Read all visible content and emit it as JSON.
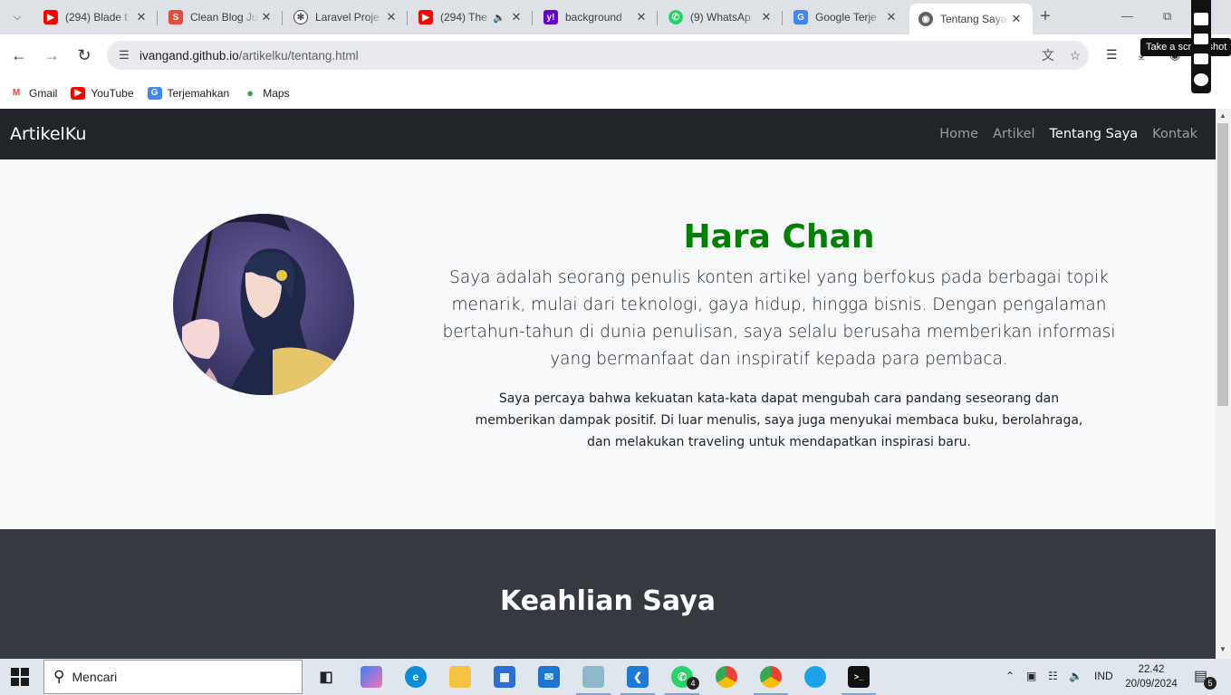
{
  "browser": {
    "tabs": [
      {
        "title": "(294) Blade t",
        "icon": "youtube-icon",
        "color": "#ff0000"
      },
      {
        "title": "Clean Blog Ju",
        "icon": "s-logo-icon",
        "color": "#e44c3c"
      },
      {
        "title": "Laravel Proje",
        "icon": "openai-icon",
        "color": "#444444"
      },
      {
        "title": "(294) The",
        "icon": "youtube-icon",
        "color": "#ff0000",
        "audio": true
      },
      {
        "title": "background",
        "icon": "yahoo-icon",
        "color": "#6001d2"
      },
      {
        "title": "(9) WhatsAp",
        "icon": "whatsapp-icon",
        "color": "#25d366"
      },
      {
        "title": "Google Terje",
        "icon": "google-translate-icon",
        "color": "#4285f4"
      },
      {
        "title": "Tentang Saya",
        "icon": "globe-icon",
        "color": "#5f6368",
        "active": true
      }
    ],
    "url_host": "ivangand.github.io",
    "url_path": "/artikelku/tentang.html",
    "bookmarks": [
      {
        "label": "Gmail",
        "icon": "gmail-icon"
      },
      {
        "label": "YouTube",
        "icon": "youtube-icon"
      },
      {
        "label": "Terjemahkan",
        "icon": "google-translate-icon"
      },
      {
        "label": "Maps",
        "icon": "maps-pin-icon"
      }
    ],
    "extension_tooltip": "Take a screenshot"
  },
  "site": {
    "brand": "ArtikelKu",
    "nav": [
      {
        "label": "Home",
        "active": false
      },
      {
        "label": "Artikel",
        "active": false
      },
      {
        "label": "Tentang Saya",
        "active": true
      },
      {
        "label": "Kontak",
        "active": false
      }
    ],
    "about": {
      "name": "Hara Chan",
      "lead": "Saya adalah seorang penulis konten artikel yang berfokus pada berbagai topik menarik, mulai dari teknologi, gaya hidup, hingga bisnis. Dengan pengalaman bertahun-tahun di dunia penulisan, saya selalu berusaha memberikan informasi yang bermanfaat dan inspiratif kepada para pembaca.",
      "body": "Saya percaya bahwa kekuatan kata-kata dapat mengubah cara pandang seseorang dan memberikan dampak positif. Di luar menulis, saya juga menyukai membaca buku, berolahraga, dan melakukan traveling untuk mendapatkan inspirasi baru."
    },
    "skills_title": "Keahlian Saya",
    "colors": {
      "name": "#008000",
      "navbar": "#212529",
      "about_bg": "#f8f9fa",
      "skills_bg": "#343a40"
    }
  },
  "taskbar": {
    "search_placeholder": "Mencari",
    "whatsapp_badge": "4",
    "language": "IND",
    "time": "22.42",
    "date": "20/09/2024",
    "notification_count": "5"
  }
}
